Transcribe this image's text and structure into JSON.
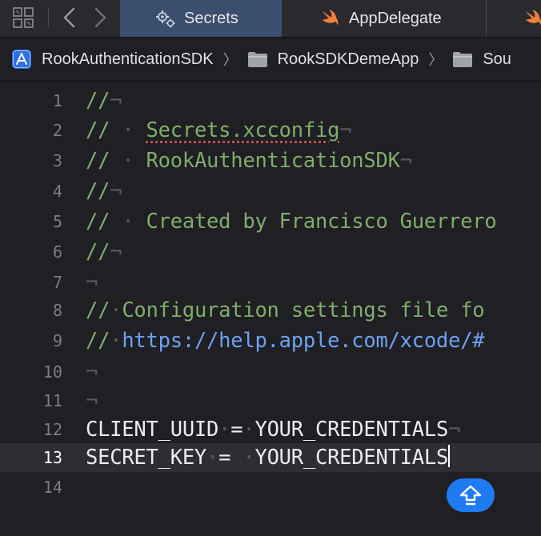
{
  "tabbar": {
    "tabs": [
      {
        "label": "Secrets",
        "icon": "gears-icon",
        "active": true
      },
      {
        "label": "AppDelegate",
        "icon": "swift-icon",
        "active": false
      },
      {
        "label": "",
        "icon": "swift-icon",
        "active": false
      }
    ]
  },
  "breadcrumb": {
    "items": [
      {
        "label": "RookAuthenticationSDK",
        "icon": "app-project-icon"
      },
      {
        "label": "RookSDKDemeApp",
        "icon": "folder-icon"
      },
      {
        "label": "Sou",
        "icon": "folder-icon"
      }
    ]
  },
  "editor": {
    "current_line": 13,
    "lines": [
      {
        "num": "1"
      },
      {
        "num": "2",
        "comment": "//",
        "text": "Secrets.xcconfig"
      },
      {
        "num": "3",
        "comment": "//",
        "text": "RookAuthenticationSDK"
      },
      {
        "num": "4"
      },
      {
        "num": "5",
        "comment": "//",
        "text": "Created by Francisco Guerrero"
      },
      {
        "num": "6"
      },
      {
        "num": "7"
      },
      {
        "num": "8",
        "comment": "//",
        "text": "Configuration settings file fo"
      },
      {
        "num": "9",
        "comment": "//",
        "text": "https://help.apple.com/xcode/#"
      },
      {
        "num": "10"
      },
      {
        "num": "11"
      },
      {
        "num": "12",
        "key": "CLIENT_UUID",
        "op": "=",
        "value": "YOUR_CREDENTIALS"
      },
      {
        "num": "13",
        "key": "SECRET_KEY",
        "op": "=",
        "value": "YOUR_CREDENTIALS"
      },
      {
        "num": "14"
      }
    ],
    "comment_marker": "//",
    "newline_marker": "¬"
  },
  "colors": {
    "comment": "#7fae6b",
    "link": "#6ea2f0",
    "active_tab": "#3a4e6e",
    "accent": "#1f7bf2"
  }
}
